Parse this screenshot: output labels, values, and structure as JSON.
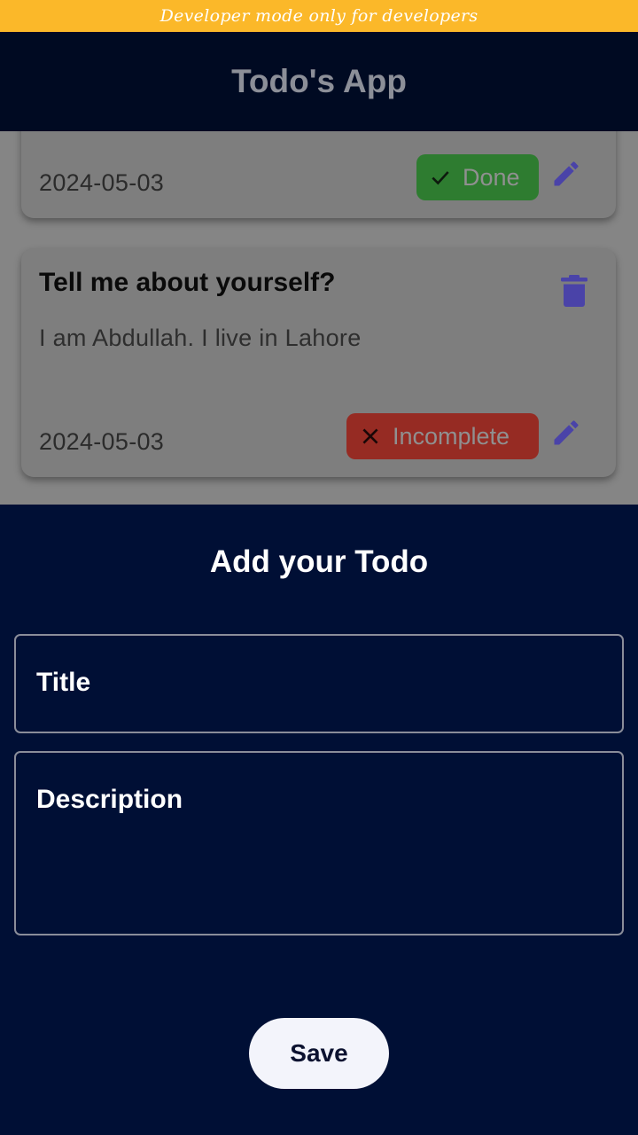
{
  "banner": {
    "text": "Developer mode only for developers"
  },
  "app_bar": {
    "title": "Todo's App"
  },
  "todos": [
    {
      "date": "2024-05-03",
      "status": "Done",
      "status_icon": "check-icon",
      "status_color": "#2e7c30"
    },
    {
      "title": "Tell me about yourself?",
      "description": "I am Abdullah. I live in Lahore",
      "date": "2024-05-03",
      "status": "Incomplete",
      "status_icon": "close-icon",
      "status_color": "#962b23"
    }
  ],
  "sheet": {
    "title": "Add your Todo",
    "title_field_label": "Title",
    "description_field_label": "Description",
    "save_label": "Save"
  },
  "colors": {
    "banner": "#fbb829",
    "app_bar": "#000a22",
    "sheet_background": "#000f35",
    "icon_accent": "#4a43a8"
  }
}
